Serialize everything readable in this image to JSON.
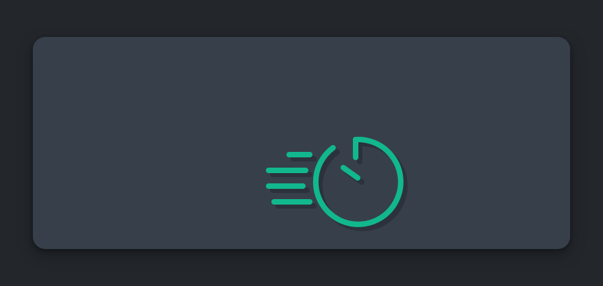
{
  "app": {
    "background_color": "#23272c",
    "card_color": "#373f4a",
    "accent_color": "#12b88d",
    "shadow_color": "#2a3039"
  },
  "icon": {
    "name": "fast-timer-icon"
  }
}
